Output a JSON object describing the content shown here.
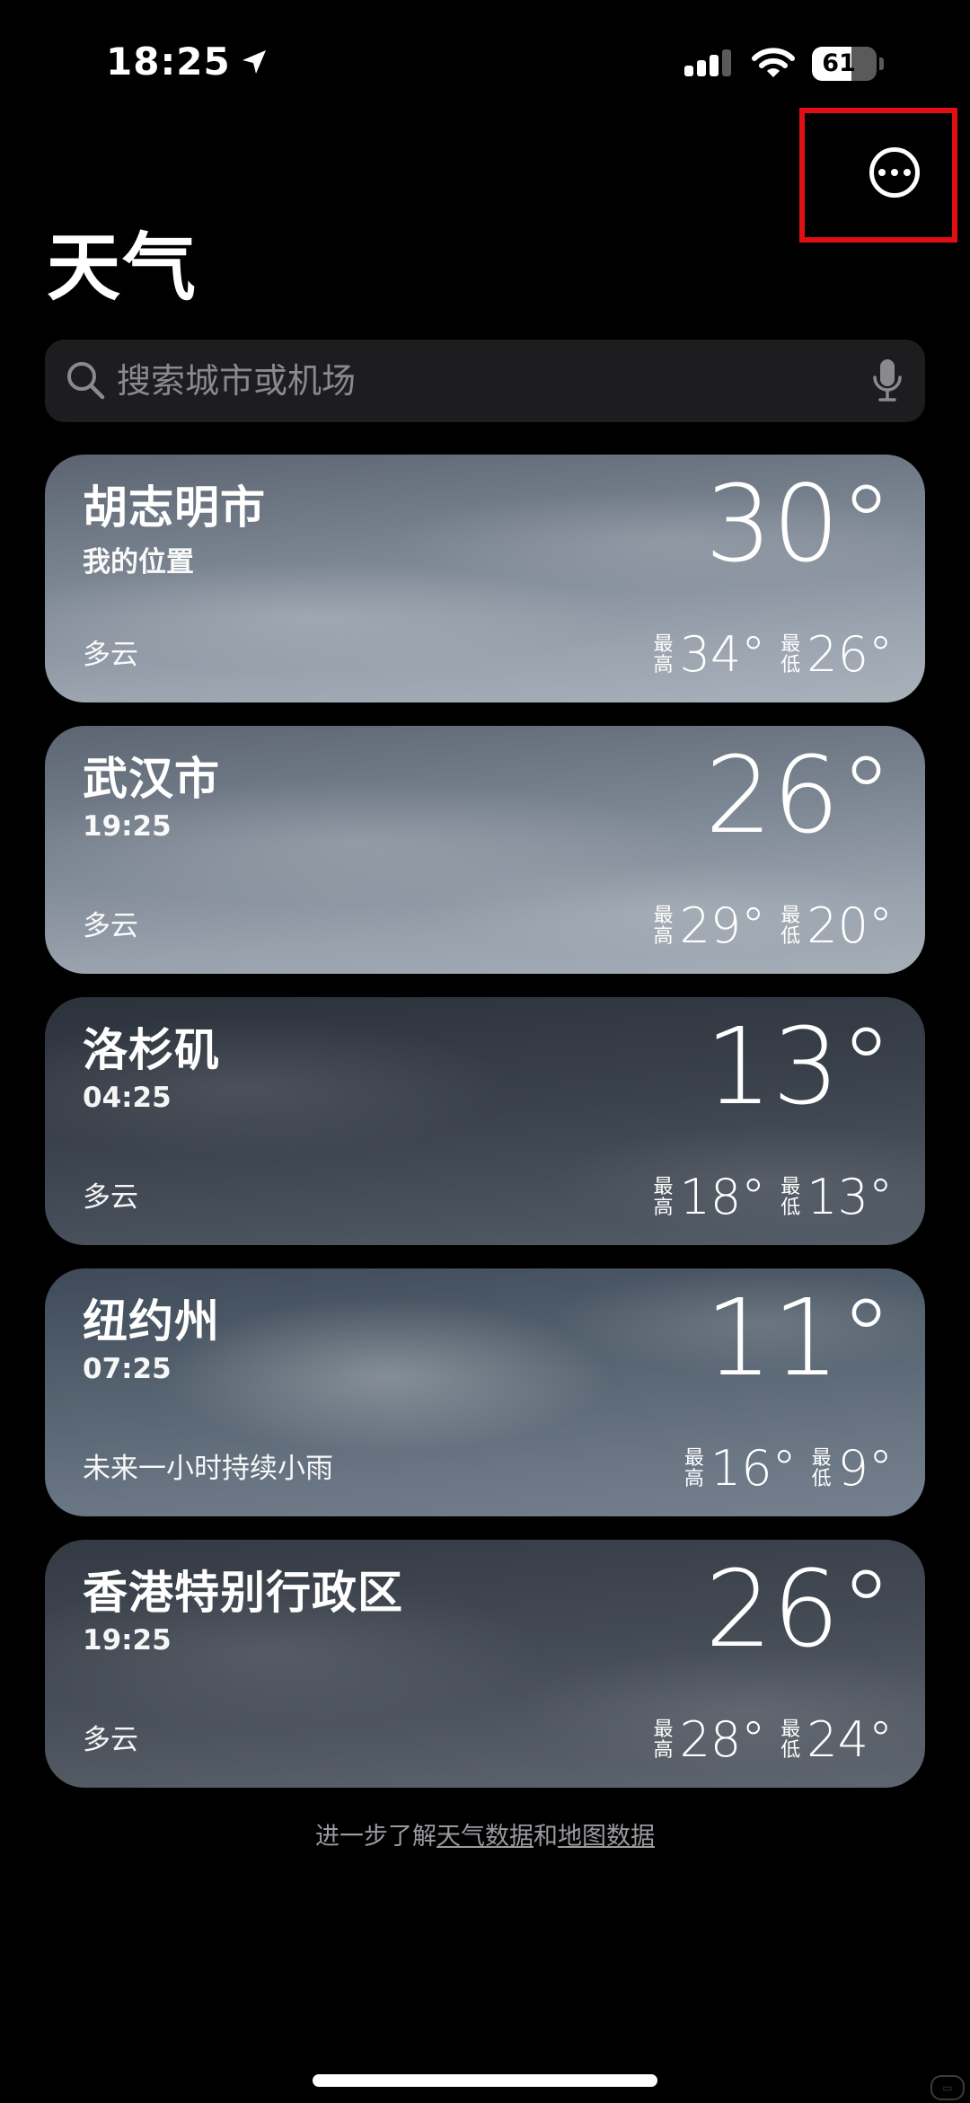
{
  "status_bar": {
    "time": "18:25",
    "battery_level": 61,
    "battery_text": "61"
  },
  "header": {
    "title": "天气",
    "more_icon": "ellipsis-circle-icon"
  },
  "search": {
    "placeholder": "搜索城市或机场",
    "mic_icon": "microphone-icon"
  },
  "cities": [
    {
      "name": "胡志明市",
      "subtitle": "我的位置",
      "temp": "30°",
      "condition": "多云",
      "high_label": "最高",
      "high": "34°",
      "low_label": "最低",
      "low": "26°"
    },
    {
      "name": "武汉市",
      "subtitle": "19:25",
      "temp": "26°",
      "condition": "多云",
      "high_label": "最高",
      "high": "29°",
      "low_label": "最低",
      "low": "20°"
    },
    {
      "name": "洛杉矶",
      "subtitle": "04:25",
      "temp": "13°",
      "condition": "多云",
      "high_label": "最高",
      "high": "18°",
      "low_label": "最低",
      "low": "13°"
    },
    {
      "name": "纽约州",
      "subtitle": "07:25",
      "temp": "11°",
      "condition": "未来一小时持续小雨",
      "high_label": "最高",
      "high": "16°",
      "low_label": "最低",
      "low": "9°"
    },
    {
      "name": "香港特别行政区",
      "subtitle": "19:25",
      "temp": "26°",
      "condition": "多云",
      "high_label": "最高",
      "high": "28°",
      "low_label": "最低",
      "low": "24°"
    }
  ],
  "footer": {
    "prefix": "进一步了解",
    "link_weather_data": "天气数据",
    "middle": "和",
    "link_map_data": "地图数据"
  },
  "colors": {
    "background": "#000000",
    "highlight_box": "#e10f14",
    "search_bg": "#1d1d1f",
    "placeholder": "#8a8a8e"
  }
}
